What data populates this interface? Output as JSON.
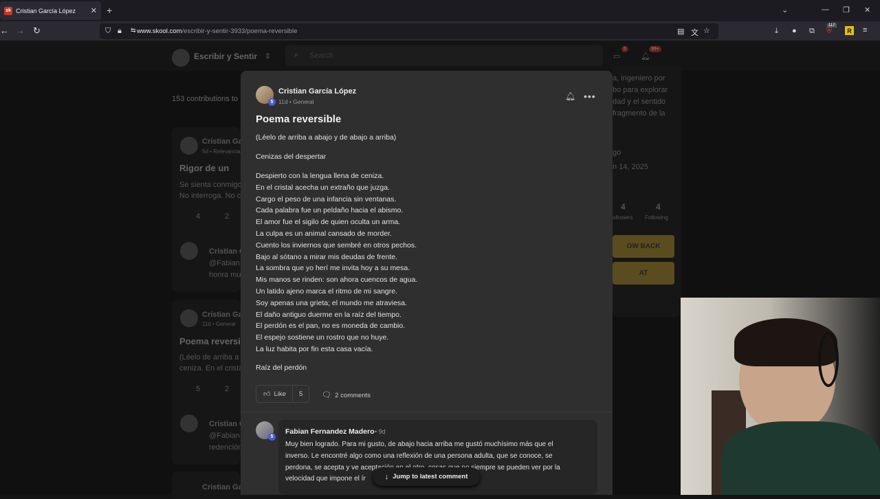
{
  "browser": {
    "tab_title": "Cristian García López",
    "tab_favicon": "sk",
    "url_domain": "www.skool.com",
    "url_path": "/escribir-y-sentir-3933/poema-reversible",
    "ext_badge": "117",
    "ext_letter": "R"
  },
  "background": {
    "community_name": "Escribir y Sentir",
    "search_placeholder": "Search",
    "chat_badge": "5",
    "notif_badge": "99+",
    "contributions": "153 contributions to",
    "card1_author": "Cristian Garc",
    "card1_meta": "5d • Relevancia",
    "card1_title": "Rigor de un",
    "card1_line1": "Se sienta conmigo",
    "card1_line2": "No interroga. No c",
    "card1_likes": "4",
    "card1_comments": "2",
    "reply1_author": "Cristian G",
    "reply1_line1": "@Fabian",
    "reply1_line2": "honra mu",
    "card2_author": "Cristian Garc",
    "card2_meta": "11d • General",
    "card2_title": "Poema reversi",
    "card2_line1": "(Léelo de arriba a",
    "card2_line2": "ceniza. En el crista",
    "card2_likes": "5",
    "card2_comments": "2",
    "reply2_author": "Cristian G",
    "reply2_line1": "@Fabian",
    "reply2_line2": "redención",
    "card3_author": "Cristian Garc",
    "bio_line1": "a, ingeniero por",
    "bio_line2": "bo para explorar",
    "bio_line3": "dad y el sentido",
    "bio_line4": "fragmento de la",
    "bio_go": "go",
    "bio_date": "n 14, 2025",
    "followers": "4",
    "followers_label": "ollowers",
    "following": "4",
    "following_label": "Following",
    "follow_back": "OW BACK",
    "chat_button": "AT"
  },
  "post": {
    "author": "Cristian García López",
    "level": "5",
    "meta": "11d • General",
    "title": "Poema reversible",
    "intro": "(Léelo de arriba a abajo y de abajo a arriba)",
    "subtitle": "Cenizas del despertar",
    "lines": [
      "Despierto con la lengua llena de ceniza.",
      "En el cristal acecha un extraño que juzga.",
      "Cargo el peso de una infancia sin ventanas.",
      "Cada palabra fue un peldaño hacia el abismo.",
      "El amor fue el sigilo de quien oculta un arma.",
      "La culpa es un animal cansado de morder.",
      "Cuento los inviernos que sembré en otros pechos.",
      "Bajo al sótano a mirar mis deudas de frente.",
      "La sombra que yo herí me invita hoy a su mesa.",
      "Mis manos se rinden: son ahora cuencos de agua.",
      "Un latido ajeno marca el ritmo de mi sangre.",
      "Soy apenas una grieta; el mundo me atraviesa.",
      "El daño antiguo duerme en la raíz del tiempo.",
      "El perdón es el pan, no es moneda de cambio.",
      "El espejo sostiene un rostro que no huye.",
      "La luz habita por fin esta casa vacía."
    ],
    "closing": "Raíz del perdón",
    "like_label": "Like",
    "like_count": "5",
    "comments_label": "2 comments"
  },
  "comment": {
    "author": "Fabian Fernandez Madero",
    "level": "5",
    "time": "9d",
    "lines": [
      "Muy bien logrado. Para mi gusto, de abajo hacia arriba me gustó muchísimo más que el",
      "inverso. Le encontré algo como una reflexión de una persona adulta, que se conoce, se",
      "perdona, se acepta y ve aceptación en el otro, cosas que no siempre se pueden ver por la",
      "velocidad que impone el ír"
    ]
  },
  "jump_label": "Jump to latest comment"
}
